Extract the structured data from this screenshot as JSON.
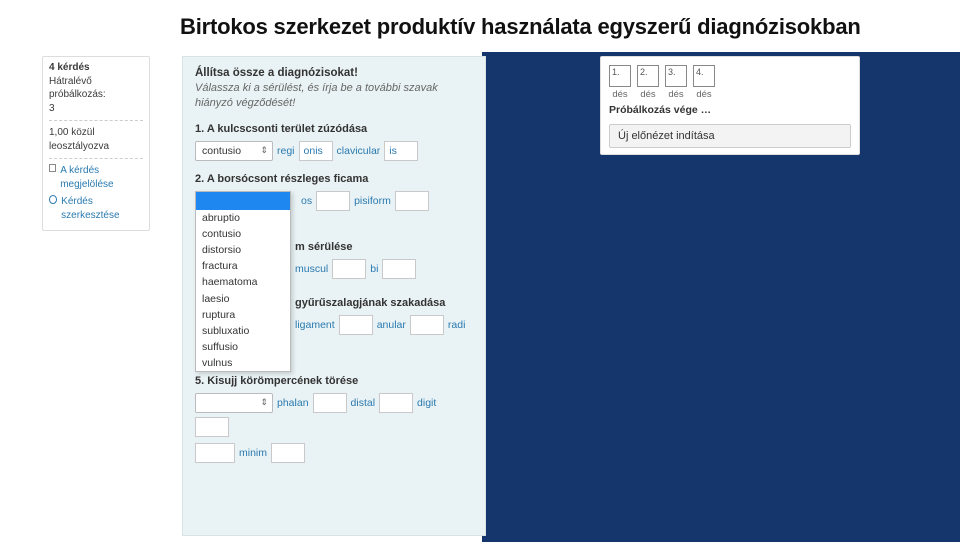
{
  "title": "Birtokos szerkezet produktív használata egyszerű diagnózisokban",
  "sidebar": {
    "line1": "4 kérdés",
    "line2": "Hátralévő próbálkozás:",
    "line3": "3",
    "line4": "1,00 közül leosztályozva",
    "flag": "A kérdés megjelölése",
    "edit": "Kérdés szerkesztése"
  },
  "quiz": {
    "header": "Állítsa össze a diagnózisokat!",
    "sub": "Válassza ki a sérülést, és írja be a további szavak hiányzó végződését!",
    "q1": {
      "title": "1. A kulcscsonti terület zúzódása",
      "sel": "contusio",
      "w1": "regi",
      "a1": "onis",
      "w2": "clavicular",
      "a2": "is"
    },
    "q2": {
      "title": "2. A borsócsont részleges ficama",
      "w1": "os",
      "w2": "pisiform"
    },
    "dropdown_options": [
      "abruptio",
      "contusio",
      "distorsio",
      "fractura",
      "haematoma",
      "laesio",
      "ruptura",
      "subluxatio",
      "suffusio",
      "vulnus"
    ],
    "q3": {
      "title_frag": "m sérülése",
      "w1": "muscul",
      "w2": "bi"
    },
    "q4": {
      "title_frag": "gyűrűszalagjának szakadása",
      "w1": "ligament",
      "w2": "anular",
      "w3": "radi"
    },
    "q5": {
      "title": "5. Kisujj körömpercének törése",
      "w1": "phalan",
      "w2": "distal",
      "w3": "digit",
      "w4": "minim"
    }
  },
  "right": {
    "slots": [
      {
        "n": "1.",
        "l": "dés"
      },
      {
        "n": "2.",
        "l": "dés"
      },
      {
        "n": "3.",
        "l": "dés"
      },
      {
        "n": "4.",
        "l": "dés"
      }
    ],
    "foot": "Próbálkozás vége …",
    "btn": "Új előnézet indítása"
  }
}
